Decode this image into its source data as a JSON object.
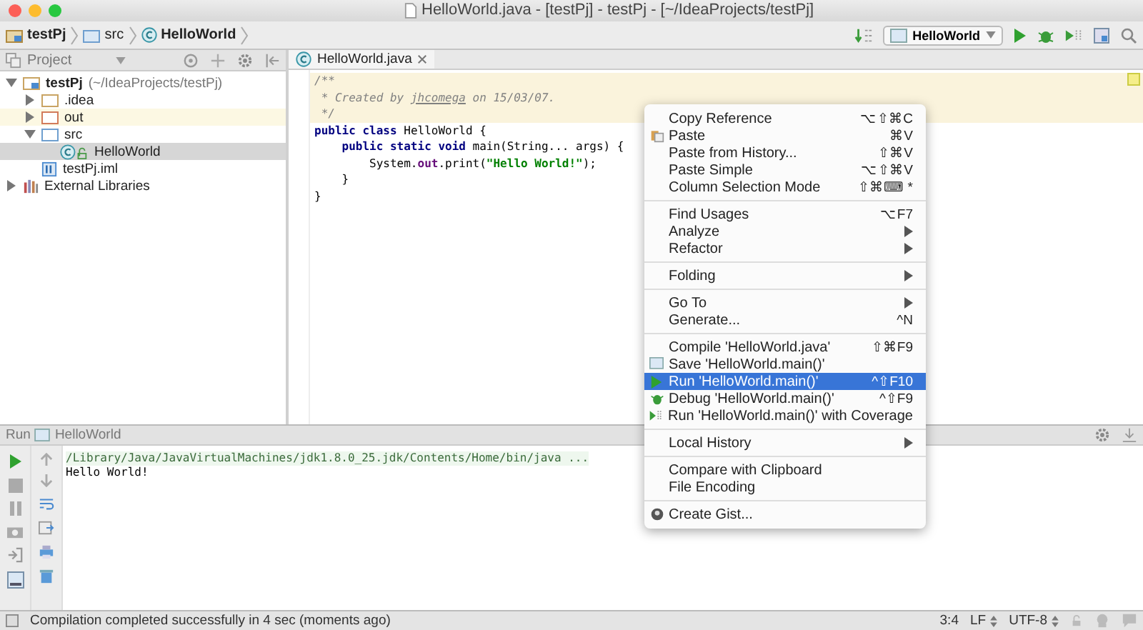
{
  "window": {
    "title": "HelloWorld.java - [testPj] - testPj - [~/IdeaProjects/testPj]"
  },
  "breadcrumbs": [
    "testPj",
    "src",
    "HelloWorld"
  ],
  "toolbar": {
    "run_config": "HelloWorld"
  },
  "project_panel": {
    "title": "Project",
    "tree": [
      {
        "label": "testPj",
        "hint": "(~/IdeaProjects/testPj)",
        "kind": "module",
        "expanded": true,
        "selected": false,
        "children": [
          {
            "label": ".idea",
            "kind": "folder",
            "expanded": false,
            "selected": false
          },
          {
            "label": "out",
            "kind": "folder-out",
            "expanded": false,
            "selected": false
          },
          {
            "label": "src",
            "kind": "folder-src",
            "expanded": true,
            "selected": false,
            "children": [
              {
                "label": "HelloWorld",
                "kind": "class",
                "selected": true
              }
            ]
          },
          {
            "label": "testPj.iml",
            "kind": "file",
            "selected": false
          }
        ]
      },
      {
        "label": "External Libraries",
        "kind": "library",
        "expanded": false,
        "selected": false
      }
    ]
  },
  "editor": {
    "tab": {
      "label": "HelloWorld.java",
      "selected": true
    },
    "lines": [
      [
        {
          "text": "/**",
          "kind": "comment"
        }
      ],
      [
        {
          "text": " * Created by ",
          "kind": "comment"
        },
        {
          "text": "jhcomega",
          "kind": "comment-link"
        },
        {
          "text": " on 15/03/07.",
          "kind": "comment"
        }
      ],
      [
        {
          "text": " */",
          "kind": "comment"
        }
      ],
      [
        {
          "text": "public class ",
          "kind": "keyword"
        },
        {
          "text": "HelloWorld {",
          "kind": "plain"
        }
      ],
      [
        {
          "text": "    public static void ",
          "kind": "keyword"
        },
        {
          "text": "main(String... args) {",
          "kind": "plain"
        }
      ],
      [
        {
          "text": "        System.",
          "kind": "plain"
        },
        {
          "text": "out",
          "kind": "field"
        },
        {
          "text": ".print(",
          "kind": "plain"
        },
        {
          "text": "\"Hello World!\"",
          "kind": "string"
        },
        {
          "text": ");",
          "kind": "plain"
        }
      ],
      [
        {
          "text": "    }",
          "kind": "plain"
        }
      ],
      [
        {
          "text": "}",
          "kind": "plain"
        }
      ]
    ]
  },
  "context_menu": {
    "groups": [
      [
        {
          "label": "Copy Reference",
          "shortcut": "⌥⇧⌘C",
          "kind": "plain",
          "submenu": false,
          "selected": false
        },
        {
          "label": "Paste",
          "shortcut": "⌘V",
          "kind": "paste",
          "submenu": false,
          "selected": false
        },
        {
          "label": "Paste from History...",
          "shortcut": "⇧⌘V",
          "kind": "plain",
          "submenu": false,
          "selected": false
        },
        {
          "label": "Paste Simple",
          "shortcut": "⌥⇧⌘V",
          "kind": "plain",
          "submenu": false,
          "selected": false
        },
        {
          "label": "Column Selection Mode",
          "shortcut": "⇧⌘⌨ *",
          "kind": "plain",
          "submenu": false,
          "selected": false
        }
      ],
      [
        {
          "label": "Find Usages",
          "shortcut": "⌥F7",
          "kind": "plain",
          "submenu": false,
          "selected": false
        },
        {
          "label": "Analyze",
          "kind": "plain",
          "submenu": true,
          "selected": false
        },
        {
          "label": "Refactor",
          "kind": "plain",
          "submenu": true,
          "selected": false
        }
      ],
      [
        {
          "label": "Folding",
          "kind": "plain",
          "submenu": true,
          "selected": false
        }
      ],
      [
        {
          "label": "Go To",
          "kind": "plain",
          "submenu": true,
          "selected": false
        },
        {
          "label": "Generate...",
          "shortcut": "^N",
          "kind": "plain",
          "submenu": false,
          "selected": false
        }
      ],
      [
        {
          "label": "Compile 'HelloWorld.java'",
          "shortcut": "⇧⌘F9",
          "kind": "plain",
          "submenu": false,
          "selected": false
        },
        {
          "label": "Save 'HelloWorld.main()'",
          "kind": "save",
          "submenu": false,
          "selected": false
        },
        {
          "label": "Run 'HelloWorld.main()'",
          "shortcut": "^⇧F10",
          "kind": "run",
          "submenu": false,
          "selected": true
        },
        {
          "label": "Debug 'HelloWorld.main()'",
          "shortcut": "^⇧F9",
          "kind": "debug",
          "submenu": false,
          "selected": false
        },
        {
          "label": "Run 'HelloWorld.main()' with Coverage",
          "kind": "coverage",
          "submenu": false,
          "selected": false
        }
      ],
      [
        {
          "label": "Local History",
          "kind": "plain",
          "submenu": true,
          "selected": false
        }
      ],
      [
        {
          "label": "Compare with Clipboard",
          "kind": "plain",
          "submenu": false,
          "selected": false
        },
        {
          "label": "File Encoding",
          "kind": "plain",
          "submenu": false,
          "selected": false
        }
      ],
      [
        {
          "label": "Create Gist...",
          "kind": "gist",
          "submenu": false,
          "selected": false
        }
      ]
    ]
  },
  "run_panel": {
    "label": "Run",
    "config": "HelloWorld",
    "console": [
      {
        "text": "/Library/Java/JavaVirtualMachines/jdk1.8.0_25.jdk/Contents/Home/bin/java ...",
        "kind": "command"
      },
      {
        "text": "Hello World!",
        "kind": "output"
      }
    ]
  },
  "status_bar": {
    "message": "Compilation completed successfully in 4 sec (moments ago)",
    "position": "3:4",
    "line_separator": "LF",
    "encoding": "UTF-8"
  }
}
